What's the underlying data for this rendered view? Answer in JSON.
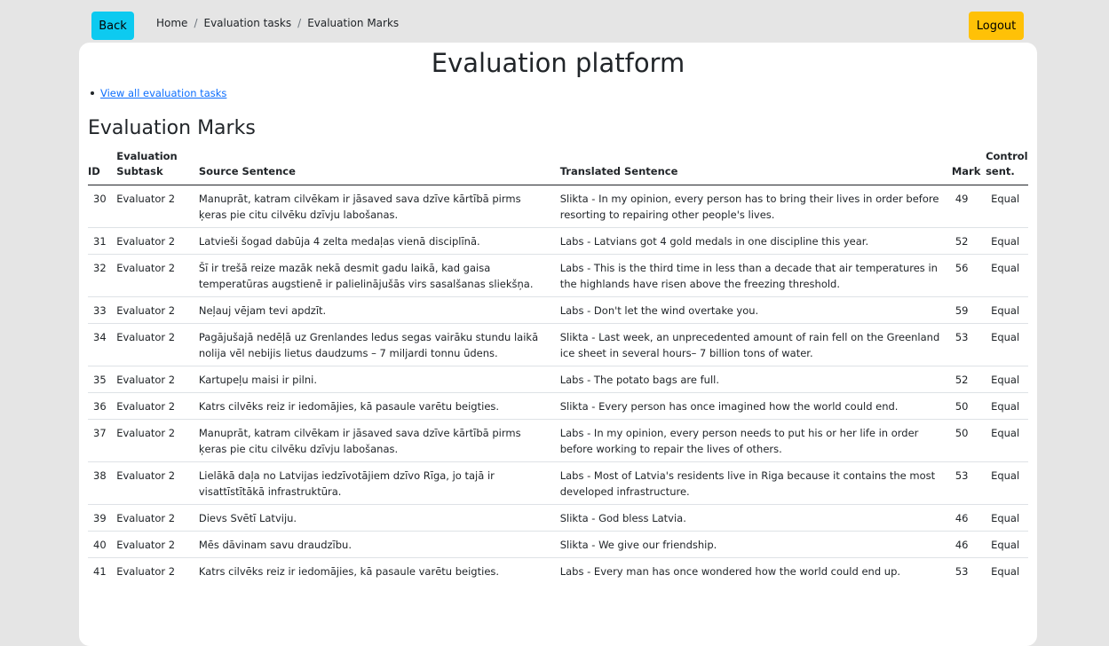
{
  "nav": {
    "back_label": "Back",
    "logout_label": "Logout",
    "breadcrumb": [
      "Home",
      "Evaluation tasks",
      "Evaluation Marks"
    ],
    "separator": "/"
  },
  "page": {
    "title": "Evaluation platform",
    "link_view_all": "View all evaluation tasks",
    "section_title": "Evaluation Marks"
  },
  "table": {
    "headers": {
      "id": "ID",
      "subtask_line1": "Evaluation",
      "subtask_line2": "Subtask",
      "source": "Source Sentence",
      "translated": "Translated Sentence",
      "mark": "Mark",
      "control_line1": "Control",
      "control_line2": "sent."
    },
    "rows": [
      {
        "id": "30",
        "subtask": "Evaluator 2",
        "source": "Manuprāt, katram cilvēkam ir jāsaved sava dzīve kārtībā pirms ķeras pie citu cilvēku dzīvju labošanas.",
        "translated": "Slikta - In my opinion, every person has to bring their lives in order before resorting to repairing other people's lives.",
        "mark": "49",
        "control": "Equal"
      },
      {
        "id": "31",
        "subtask": "Evaluator 2",
        "source": "Latvieši šogad dabūja 4 zelta medaļas vienā disciplīnā.",
        "translated": "Labs - Latvians got 4 gold medals in one discipline this year.",
        "mark": "52",
        "control": "Equal"
      },
      {
        "id": "32",
        "subtask": "Evaluator 2",
        "source": "Šī ir trešā reize mazāk nekā desmit gadu laikā, kad gaisa temperatūras augstienē ir palielinājušās virs sasalšanas sliekšņa.",
        "translated": "Labs - This is the third time in less than a decade that air temperatures in the highlands have risen above the freezing threshold.",
        "mark": "56",
        "control": "Equal"
      },
      {
        "id": "33",
        "subtask": "Evaluator 2",
        "source": "Neļauj vējam tevi apdzīt.",
        "translated": "Labs - Don't let the wind overtake you.",
        "mark": "59",
        "control": "Equal"
      },
      {
        "id": "34",
        "subtask": "Evaluator 2",
        "source": "Pagājušajā nedēļā uz Grenlandes ledus segas vairāku stundu laikā nolija vēl nebijis lietus daudzums – 7 miljardi tonnu ūdens.",
        "translated": "Slikta - Last week, an unprecedented amount of rain fell on the Greenland ice sheet in several hours– 7 billion tons of water.",
        "mark": "53",
        "control": "Equal"
      },
      {
        "id": "35",
        "subtask": "Evaluator 2",
        "source": "Kartupeļu maisi ir pilni.",
        "translated": "Labs - The potato bags are full.",
        "mark": "52",
        "control": "Equal"
      },
      {
        "id": "36",
        "subtask": "Evaluator 2",
        "source": "Katrs cilvēks reiz ir iedomājies, kā pasaule varētu beigties.",
        "translated": "Slikta - Every person has once imagined how the world could end.",
        "mark": "50",
        "control": "Equal"
      },
      {
        "id": "37",
        "subtask": "Evaluator 2",
        "source": "Manuprāt, katram cilvēkam ir jāsaved sava dzīve kārtībā pirms ķeras pie citu cilvēku dzīvju labošanas.",
        "translated": "Labs - In my opinion, every person needs to put his or her life in order before working to repair the lives of others.",
        "mark": "50",
        "control": "Equal"
      },
      {
        "id": "38",
        "subtask": "Evaluator 2",
        "source": "Lielākā daļa no Latvijas iedzīvotājiem dzīvo Rīga, jo tajā ir visattīstītākā infrastruktūra.",
        "translated": "Labs - Most of Latvia's residents live in Riga because it contains the most developed infrastructure.",
        "mark": "53",
        "control": "Equal"
      },
      {
        "id": "39",
        "subtask": "Evaluator 2",
        "source": "Dievs Svētī Latviju.",
        "translated": "Slikta - God bless Latvia.",
        "mark": "46",
        "control": "Equal"
      },
      {
        "id": "40",
        "subtask": "Evaluator 2",
        "source": "Mēs dāvinam savu draudzību.",
        "translated": "Slikta - We give our friendship.",
        "mark": "46",
        "control": "Equal"
      },
      {
        "id": "41",
        "subtask": "Evaluator 2",
        "source": "Katrs cilvēks reiz ir iedomājies, kā pasaule varētu beigties.",
        "translated": "Labs - Every man has once wondered how the world could end up.",
        "mark": "53",
        "control": "Equal"
      }
    ]
  }
}
